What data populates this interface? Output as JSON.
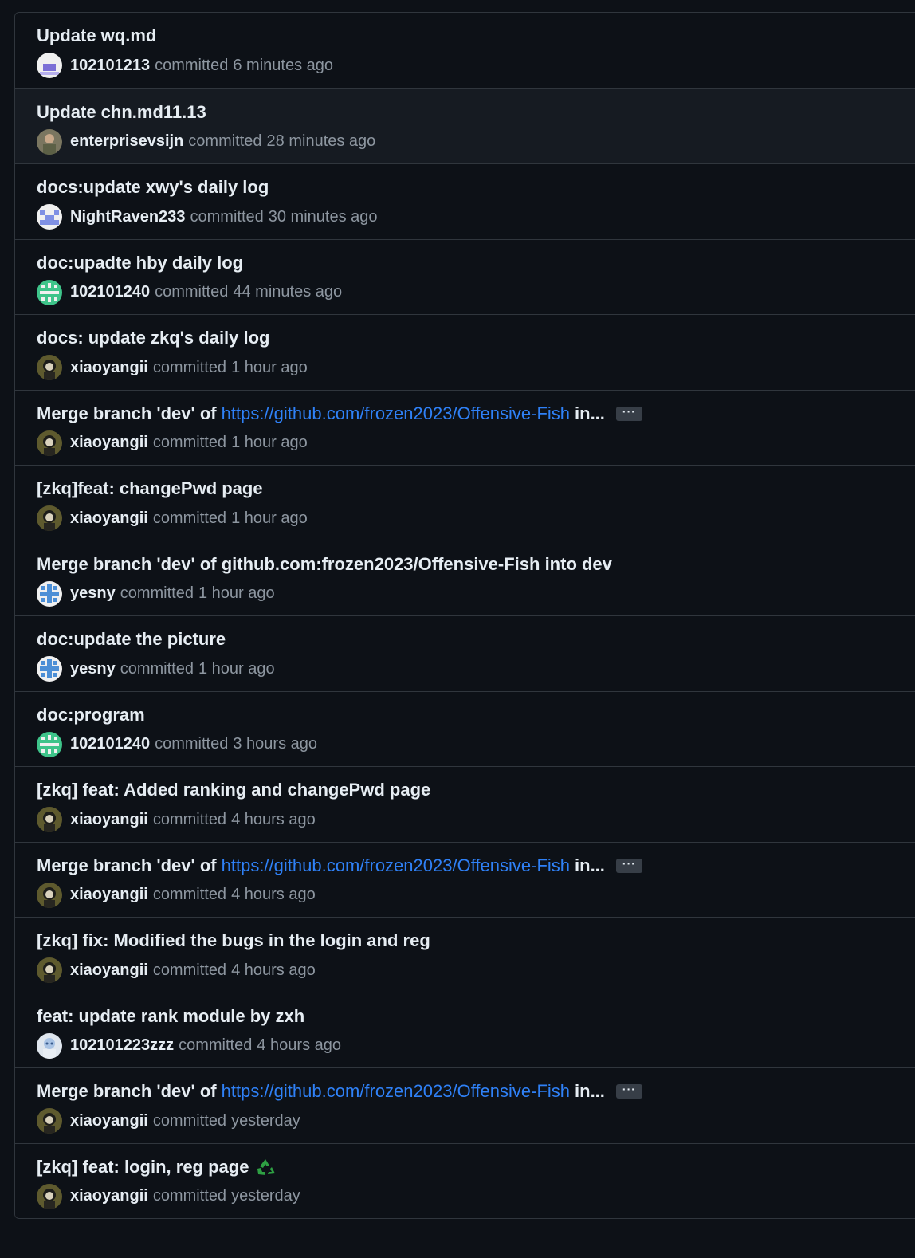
{
  "commits": [
    {
      "title": "Update wq.md",
      "author": "102101213",
      "time": "6 minutes ago",
      "avatar": "white-purple-avatar"
    },
    {
      "title": "Update chn.md11.13",
      "author": "enterprisevsijn",
      "time": "28 minutes ago",
      "avatar": "photo-avatar"
    },
    {
      "title": "docs:update xwy's daily log",
      "author": "NightRaven233",
      "time": "30 minutes ago",
      "avatar": "blue-pixel-avatar"
    },
    {
      "title": "doc:upadte hby daily log",
      "author": "102101240",
      "time": "44 minutes ago",
      "avatar": "green-pixel-avatar"
    },
    {
      "title": "docs: update zkq's daily log",
      "author": "xiaoyangii",
      "time": "1 hour ago",
      "avatar": "dark-photo-avatar"
    },
    {
      "title": "Merge branch 'dev' of",
      "link": "https://github.com/frozen2023/Offensive-Fish",
      "suffix": "in...",
      "more": "···",
      "author": "xiaoyangii",
      "time": "1 hour ago",
      "avatar": "dark-photo-avatar"
    },
    {
      "title": "[zkq]feat: changePwd page",
      "author": "xiaoyangii",
      "time": "1 hour ago",
      "avatar": "dark-photo-avatar"
    },
    {
      "title": "Merge branch 'dev' of github.com:frozen2023/Offensive-Fish into dev",
      "author": "yesny",
      "time": "1 hour ago",
      "avatar": "lightblue-pixel-avatar"
    },
    {
      "title": "doc:update the picture",
      "author": "yesny",
      "time": "1 hour ago",
      "avatar": "lightblue-pixel-avatar"
    },
    {
      "title": "doc:program",
      "author": "102101240",
      "time": "3 hours ago",
      "avatar": "green-pixel-avatar"
    },
    {
      "title": "[zkq] feat: Added ranking and changePwd page",
      "author": "xiaoyangii",
      "time": "4 hours ago",
      "avatar": "dark-photo-avatar"
    },
    {
      "title": "Merge branch 'dev' of",
      "link": "https://github.com/frozen2023/Offensive-Fish",
      "suffix": "in...",
      "more": "···",
      "author": "xiaoyangii",
      "time": "4 hours ago",
      "avatar": "dark-photo-avatar"
    },
    {
      "title": "[zkq] fix: Modified the bugs in the login and reg",
      "author": "xiaoyangii",
      "time": "4 hours ago",
      "avatar": "dark-photo-avatar"
    },
    {
      "title": "feat: update rank module by zxh",
      "author": "102101223zzz",
      "time": "4 hours ago",
      "avatar": "anime-avatar"
    },
    {
      "title": "Merge branch 'dev' of",
      "link": "https://github.com/frozen2023/Offensive-Fish",
      "suffix": "in...",
      "more": "···",
      "author": "xiaoyangii",
      "time": "yesterday",
      "avatar": "dark-photo-avatar"
    },
    {
      "title": "[zkq] feat: login, reg page",
      "emoji": "recycle-icon",
      "author": "xiaoyangii",
      "time": "yesterday",
      "avatar": "dark-photo-avatar"
    }
  ],
  "committed_label": "committed",
  "colors": {
    "background": "#0d1117",
    "hover_row": "#161b22",
    "border": "#30363d",
    "link": "#2f81f7",
    "text": "#e6edf3",
    "muted": "#8d96a0"
  }
}
